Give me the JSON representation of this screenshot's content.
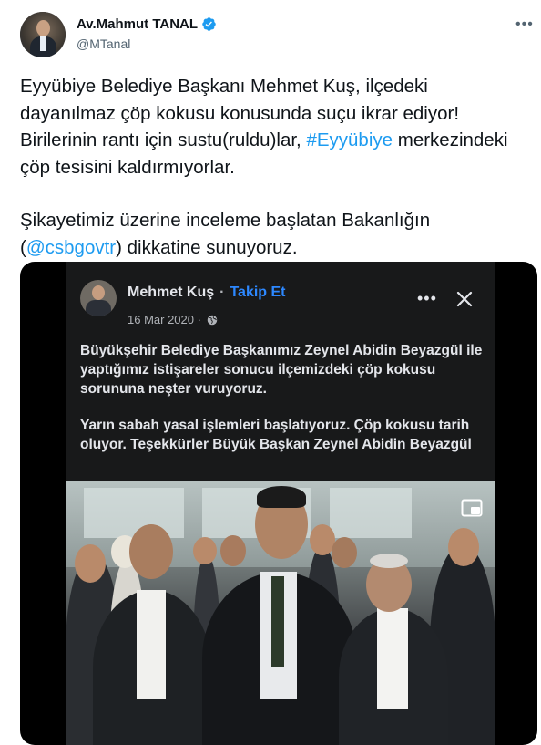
{
  "author": {
    "name": "Av.Mahmut TANAL",
    "handle": "@MTanal"
  },
  "icons": {
    "verified": "verified-badge-icon",
    "more": "more-horizontal-icon",
    "globe": "globe-icon",
    "close": "close-icon",
    "pip": "picture-in-picture-icon"
  },
  "colors": {
    "accent": "#1d9bf0",
    "fb_link": "#2d88ff",
    "fb_bg": "#18191a"
  },
  "tweet": {
    "p1_part1": "Eyyübiye Belediye Başkanı Mehmet Kuş, ilçedeki dayanılmaz çöp kokusu konusunda suçu ikrar ediyor! Birilerinin rantı için sustu(ruldu)lar, ",
    "p1_hashtag": "#Eyyübiye",
    "p1_part2": " merkezindeki çöp tesisini kaldırmıyorlar.",
    "p2_part1": "Şikayetimiz üzerine inceleme başlatan Bakanlığın (",
    "p2_mention": "@csbgovtr",
    "p2_part2": ") dikkatine sunuyoruz."
  },
  "fb_post": {
    "name": "Mehmet Kuş",
    "dot": "·",
    "follow": "Takip Et",
    "date": "16 Mar 2020 ·",
    "text_p1": "Büyükşehir Belediye Başkanımız Zeynel Abidin Beyazgül ile yaptığımız istişareler sonucu ilçemizdeki çöp kokusu sorununa neşter vuruyoruz.",
    "text_p2": "Yarın sabah yasal işlemleri başlatıyoruz. Çöp kokusu tarih oluyor. Teşekkürler Büyük Başkan Zeynel Abidin Beyazgül"
  }
}
